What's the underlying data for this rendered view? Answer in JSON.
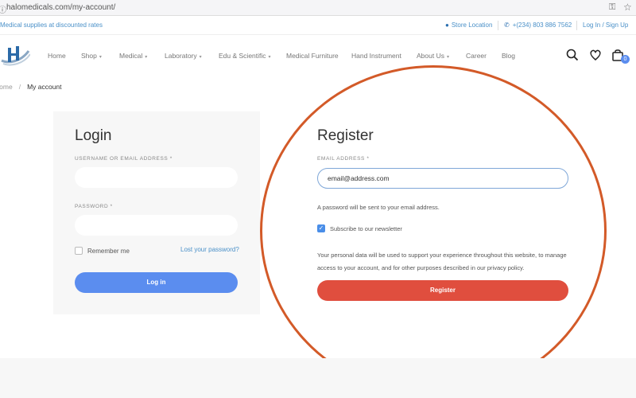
{
  "browser": {
    "url": "halomedicals.com/my-account/"
  },
  "topbar": {
    "promo": "Medical supplies at discounted rates",
    "store_location": "Store Location",
    "phone": "+(234) 803 886 7562",
    "login_signup": "Log In / Sign Up"
  },
  "nav": {
    "items": [
      {
        "label": "Home"
      },
      {
        "label": "Shop"
      },
      {
        "label": "Medical"
      },
      {
        "label": "Laboratory"
      },
      {
        "label": "Edu & Scientific"
      },
      {
        "label": "Medical Furniture"
      },
      {
        "label": "Hand Instrument"
      },
      {
        "label": "About Us"
      },
      {
        "label": "Career"
      },
      {
        "label": "Blog"
      }
    ],
    "cart_count": "0"
  },
  "breadcrumb": {
    "home": "Home",
    "current": "My account"
  },
  "login": {
    "title": "Login",
    "username_label": "USERNAME OR EMAIL ADDRESS *",
    "password_label": "PASSWORD *",
    "remember_label": "Remember me",
    "lost_password": "Lost your password?",
    "button": "Log in"
  },
  "register": {
    "title": "Register",
    "email_label": "EMAIL ADDRESS *",
    "email_value": "email@address.com",
    "note": "A password will be sent to your email address.",
    "subscribe_label": "Subscribe to our newsletter",
    "privacy_text": "Your personal data will be used to support your experience throughout this website, to manage access to your account, and for other purposes described in our privacy policy.",
    "button": "Register"
  },
  "colors": {
    "accent_blue": "#5b8def",
    "register_red": "#e04e3e",
    "highlight_circle": "#d35a28"
  }
}
